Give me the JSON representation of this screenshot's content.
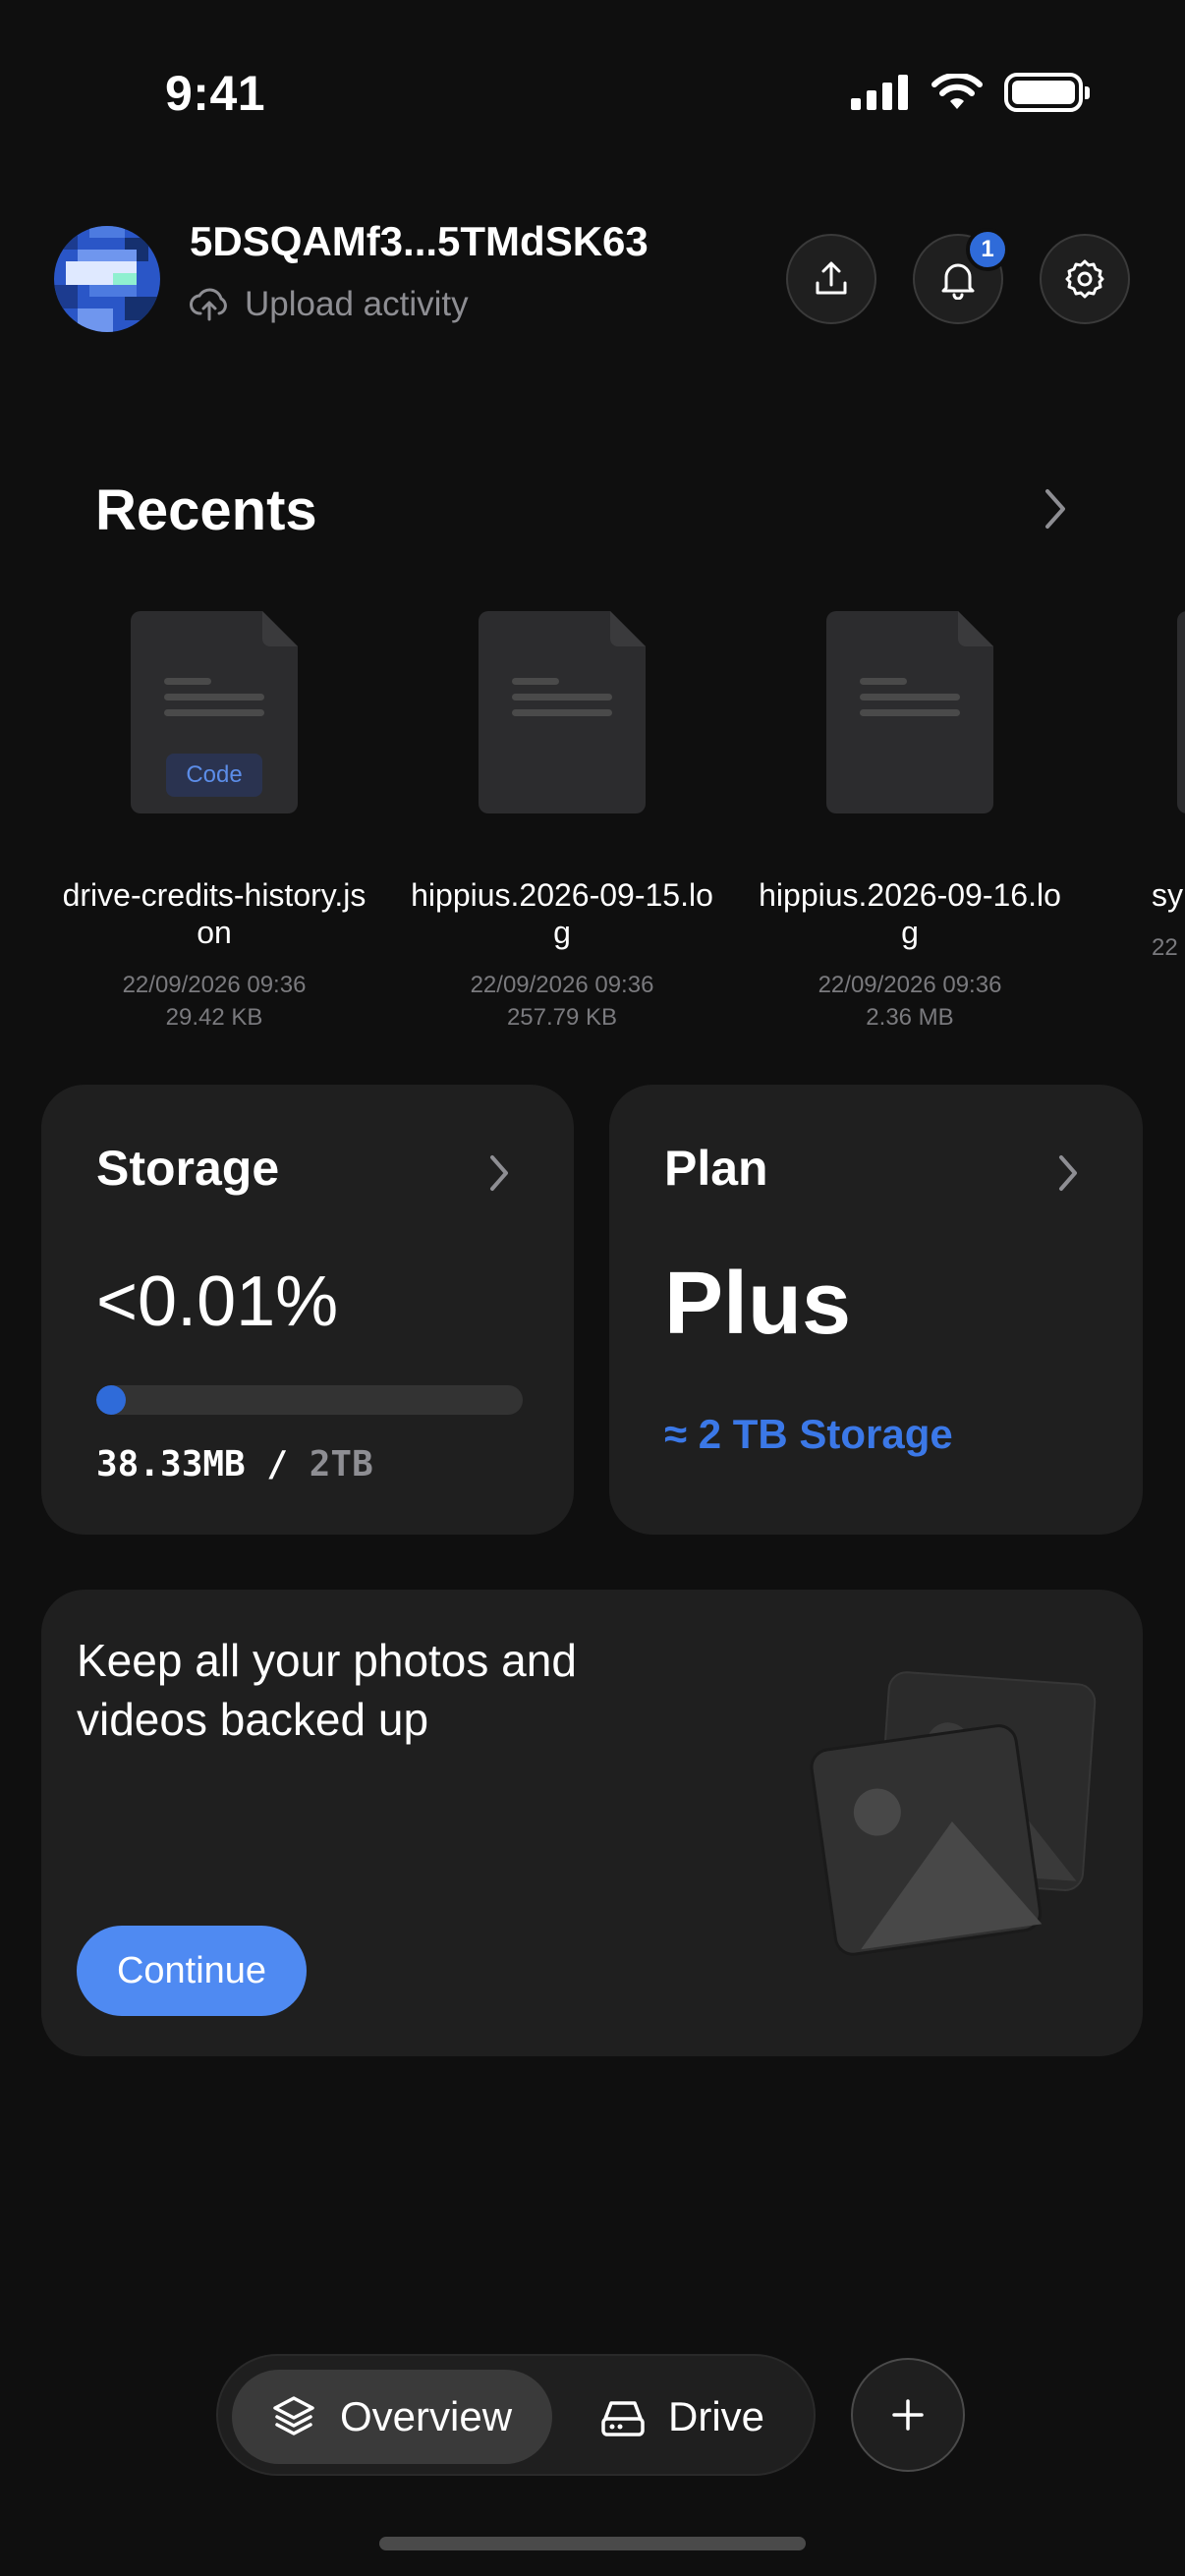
{
  "status_bar": {
    "time": "9:41"
  },
  "header": {
    "account_name": "5DSQAMf3...5TMdSK63",
    "upload_activity_label": "Upload activity",
    "notification_count": "1"
  },
  "recents": {
    "title": "Recents",
    "items": [
      {
        "name": "drive-credits-history.json",
        "date": "22/09/2026 09:36",
        "size": "29.42 KB",
        "tag": "Code"
      },
      {
        "name": "hippius.2026-09-15.log",
        "date": "22/09/2026 09:36",
        "size": "257.79 KB"
      },
      {
        "name": "hippius.2026-09-16.log",
        "date": "22/09/2026 09:36",
        "size": "2.36 MB"
      },
      {
        "name": "sy",
        "date": "22"
      }
    ]
  },
  "storage": {
    "title": "Storage",
    "percent_label": "<0.01%",
    "used": "38.33MB",
    "separator": " / ",
    "total": "2TB",
    "fill_fraction": 0.0001
  },
  "plan": {
    "title": "Plan",
    "name": "Plus",
    "storage_label": "≈ 2 TB Storage"
  },
  "backup": {
    "text": "Keep all your photos and videos backed up",
    "button_label": "Continue"
  },
  "nav": {
    "overview_label": "Overview",
    "drive_label": "Drive"
  },
  "colors": {
    "accent": "#2f6bd9",
    "button": "#4f8af2",
    "background": "#0f0f0f",
    "card": "#1f1f1f"
  }
}
